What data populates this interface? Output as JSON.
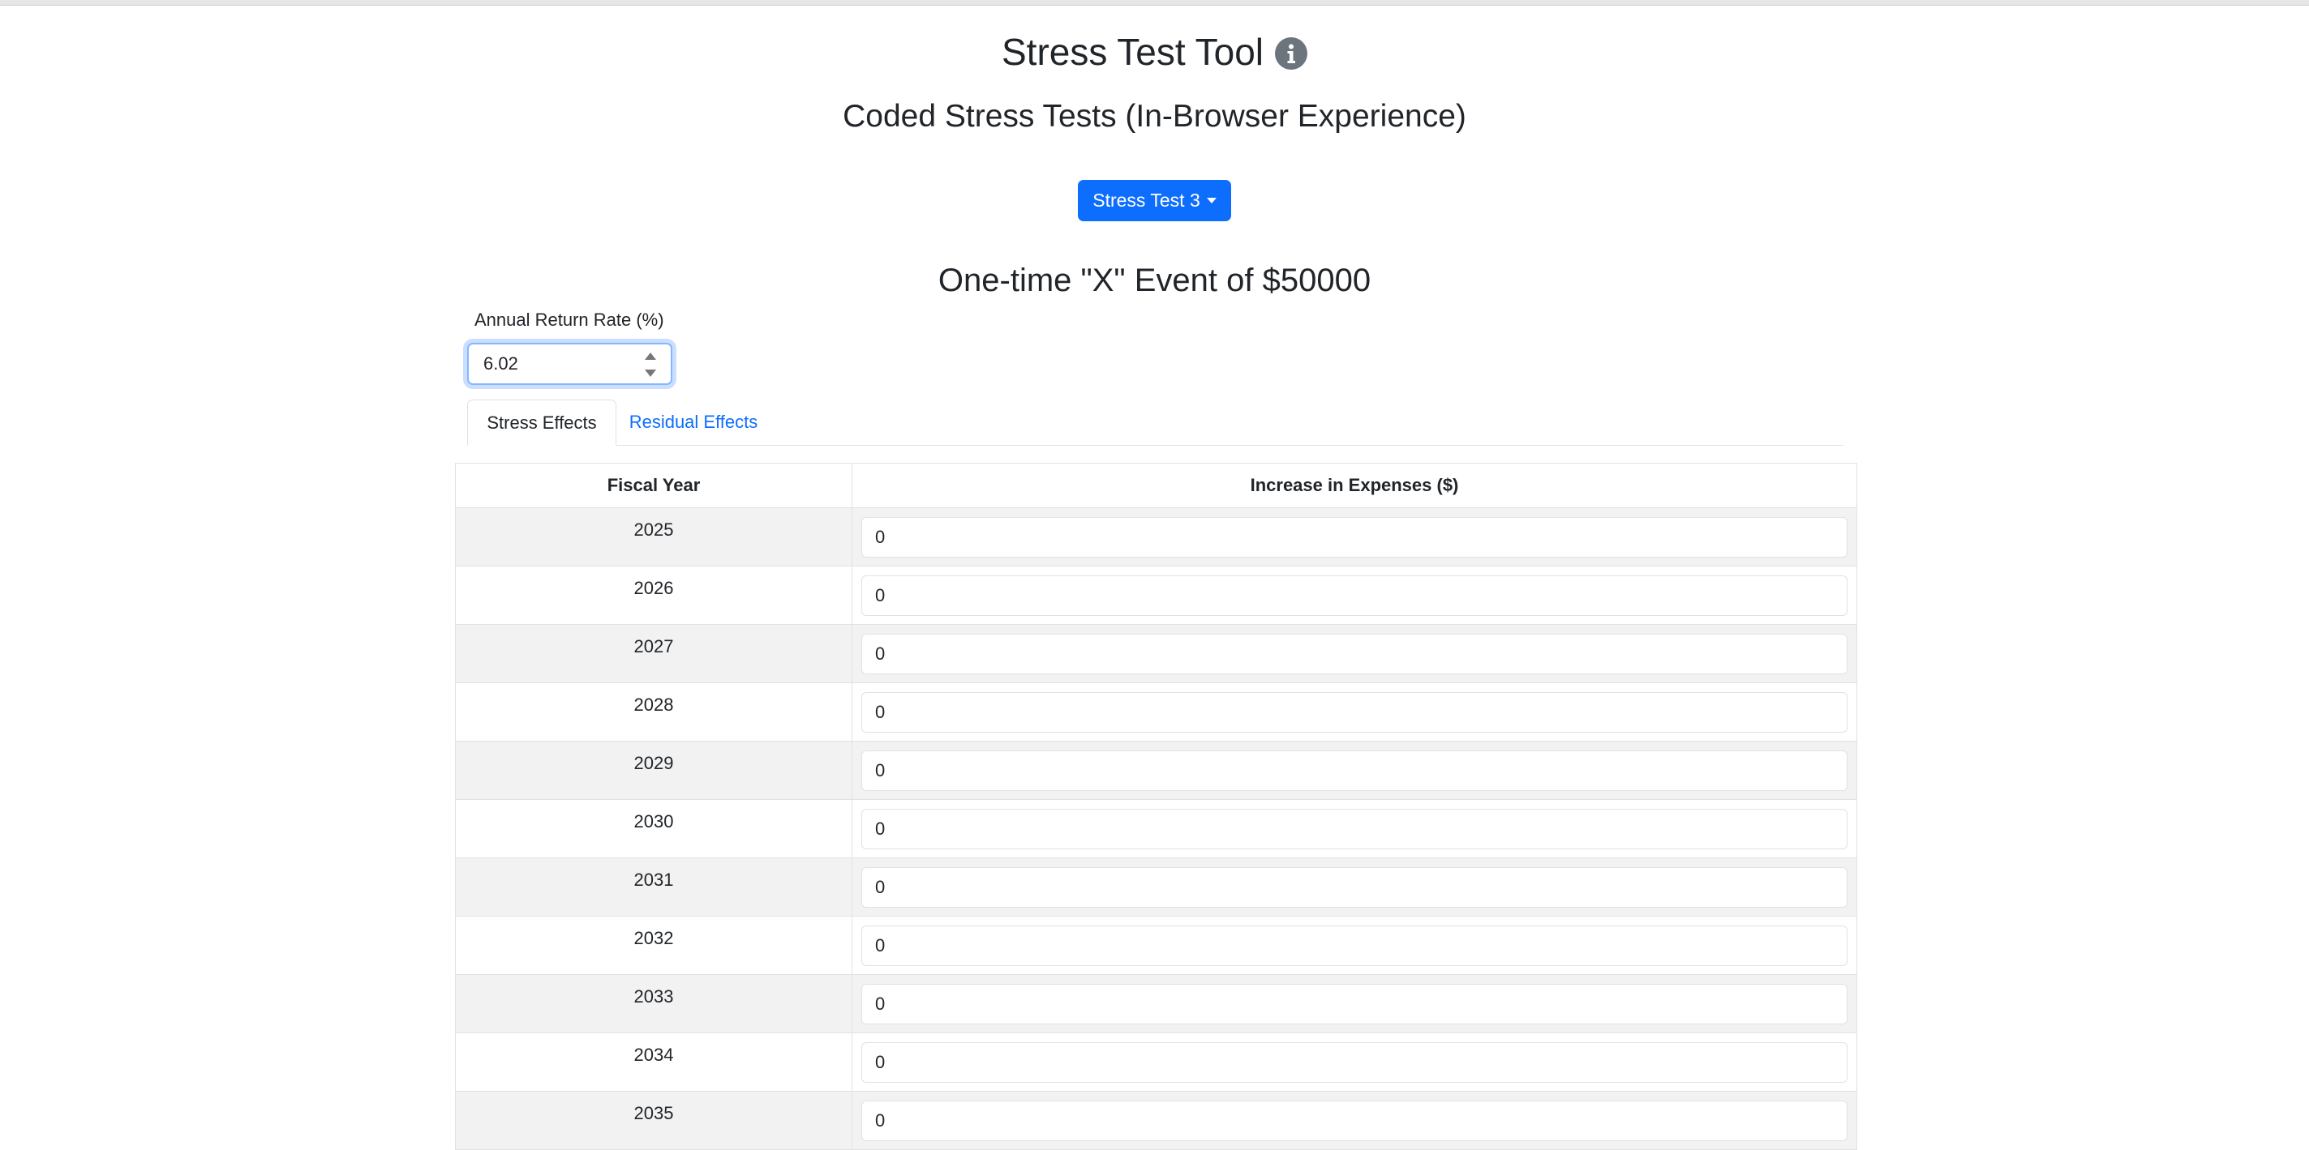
{
  "header": {
    "title": "Stress Test Tool",
    "info_icon": "info-circle-icon",
    "subtitle": "Coded Stress Tests (In-Browser Experience)"
  },
  "selector": {
    "label": "Stress Test 3",
    "icon": "caret-down-icon"
  },
  "scenario": {
    "title": "One-time \"X\" Event of $50000"
  },
  "rate": {
    "label": "Annual Return Rate (%)",
    "value": "6.02"
  },
  "tabs": [
    {
      "label": "Stress Effects",
      "active": true
    },
    {
      "label": "Residual Effects",
      "active": false
    }
  ],
  "table": {
    "headers": [
      "Fiscal Year",
      "Increase in Expenses ($)"
    ],
    "rows": [
      {
        "year": "2025",
        "value": "0"
      },
      {
        "year": "2026",
        "value": "0"
      },
      {
        "year": "2027",
        "value": "0"
      },
      {
        "year": "2028",
        "value": "0"
      },
      {
        "year": "2029",
        "value": "0"
      },
      {
        "year": "2030",
        "value": "0"
      },
      {
        "year": "2031",
        "value": "0"
      },
      {
        "year": "2032",
        "value": "0"
      },
      {
        "year": "2033",
        "value": "0"
      },
      {
        "year": "2034",
        "value": "0"
      },
      {
        "year": "2035",
        "value": "0"
      }
    ]
  },
  "colors": {
    "primary": "#0d6efd",
    "stripe": "#f2f2f2",
    "border": "#dee2e6",
    "icon_gray": "#6c757d"
  }
}
